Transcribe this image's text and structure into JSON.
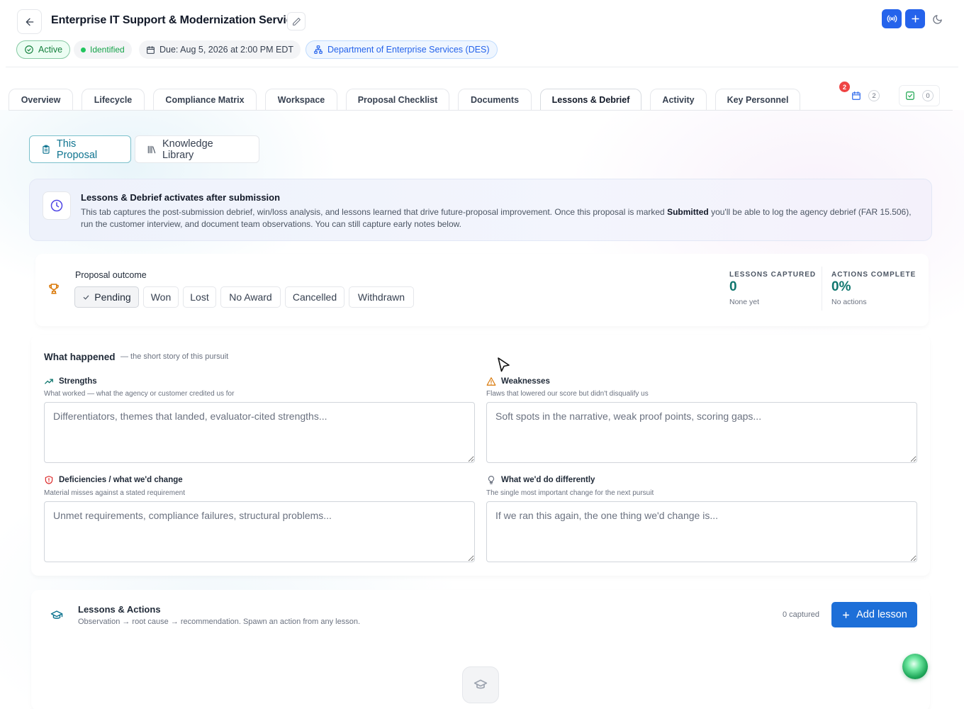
{
  "header": {
    "title": "Enterprise IT Support & Modernization Services",
    "status": "Active",
    "stage": "Identified",
    "due": "Due: Aug 5, 2026 at 2:00 PM EDT",
    "agency": "Department of Enterprise Services (DES)"
  },
  "tabs": [
    {
      "label": "Overview"
    },
    {
      "label": "Lifecycle"
    },
    {
      "label": "Compliance Matrix"
    },
    {
      "label": "Workspace"
    },
    {
      "label": "Proposal Checklist"
    },
    {
      "label": "Documents"
    },
    {
      "label": "Lessons & Debrief",
      "active": true
    },
    {
      "label": "Activity"
    },
    {
      "label": "Key Personnel"
    }
  ],
  "counters": {
    "calendar_alert": "2",
    "calendar_count": "2",
    "tasks_count": "0"
  },
  "subtabs": {
    "this_proposal": "This Proposal",
    "knowledge_library": "Knowledge Library"
  },
  "banner": {
    "title": "Lessons & Debrief activates after submission",
    "body_before": "This tab captures the post-submission debrief, win/loss analysis, and lessons learned that drive future-proposal improvement. Once this proposal is marked ",
    "body_bold": "Submitted",
    "body_after": " you'll be able to log the agency debrief (FAR 15.506), run the customer interview, and document team observations. You can still capture early notes below."
  },
  "outcome": {
    "label": "Proposal outcome",
    "options": [
      "Pending",
      "Won",
      "Lost",
      "No Award",
      "Cancelled",
      "Withdrawn"
    ],
    "selected": "Pending",
    "stats": [
      {
        "caption": "LESSONS CAPTURED",
        "value": "0",
        "sub": "None yet"
      },
      {
        "caption": "ACTIONS COMPLETE",
        "value": "0%",
        "sub": "No actions"
      }
    ]
  },
  "happened": {
    "title": "What happened",
    "subtitle": "— the short story of this pursuit",
    "fields": [
      {
        "label": "Strengths",
        "help": "What worked — what the agency or customer credited us for",
        "placeholder": "Differentiators, themes that landed, evaluator-cited strengths...",
        "icon": "trending-up-icon",
        "color": "#0f766e"
      },
      {
        "label": "Weaknesses",
        "help": "Flaws that lowered our score but didn't disqualify us",
        "placeholder": "Soft spots in the narrative, weak proof points, scoring gaps...",
        "icon": "warning-icon",
        "color": "#d97706"
      },
      {
        "label": "Deficiencies / what we'd change",
        "help": "Material misses against a stated requirement",
        "placeholder": "Unmet requirements, compliance failures, structural problems...",
        "icon": "shield-alert-icon",
        "color": "#dc2626"
      },
      {
        "label": "What we'd do differently",
        "help": "The single most important change for the next pursuit",
        "placeholder": "If we ran this again, the one thing we'd change is...",
        "icon": "lightbulb-icon",
        "color": "#6b7280"
      }
    ]
  },
  "lessons": {
    "title": "Lessons & Actions",
    "subtitle": "Observation → root cause → recommendation. Spawn an action from any lesson.",
    "captured": "0 captured",
    "add_label": "Add lesson"
  },
  "colors": {
    "primary": "#2563eb",
    "accent_teal": "#0f766e",
    "success": "#16a34a"
  }
}
